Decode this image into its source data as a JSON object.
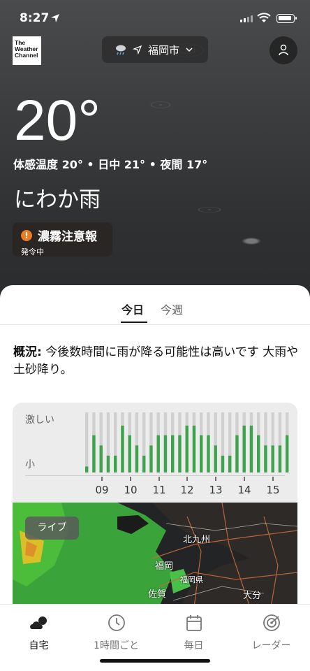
{
  "status": {
    "time": "8:27"
  },
  "brand": {
    "logo_text_1": "The",
    "logo_text_2": "Weather",
    "logo_text_3": "Channel"
  },
  "location": {
    "name": "福岡市",
    "weather_icon": "rain-cloud-icon"
  },
  "current": {
    "temperature": "20°",
    "feels_line": "体感温度 20° • 日中 21° • 夜間 17°",
    "condition": "にわか雨"
  },
  "alert": {
    "title": "濃霧注意報",
    "status": "発令中",
    "color": "#f07b1e"
  },
  "tabs": [
    {
      "label": "今日"
    },
    {
      "label": "今週"
    }
  ],
  "summary": {
    "label": "概況:",
    "text": "今後数時間に雨が降る可能性は高いです 大雨や土砂降り。"
  },
  "chart_data": {
    "type": "bar",
    "ylabels": [
      "激しい",
      "小"
    ],
    "x_ticks": [
      "09",
      "10",
      "11",
      "12",
      "13",
      "14",
      "15"
    ],
    "values": [
      0.1,
      0.62,
      0.45,
      0.28,
      0.28,
      0.78,
      0.62,
      0.45,
      0.28,
      0.45,
      0.62,
      0.62,
      0.62,
      0.62,
      0.78,
      0.78,
      0.62,
      0.62,
      0.45,
      0.28,
      0.28,
      0.62,
      0.78,
      0.78,
      0.62,
      0.45,
      0.45,
      0.45,
      0.62
    ],
    "ylim": [
      0,
      1
    ],
    "bar_color": "#3fa34d",
    "track_color": "#d0d0d0"
  },
  "map": {
    "live_label": "ライブ",
    "cities": [
      "北九州",
      "福岡",
      "福岡県",
      "佐賀",
      "大分"
    ]
  },
  "nav": [
    {
      "label": "自宅",
      "icon": "home-weather-icon"
    },
    {
      "label": "1時間ごと",
      "icon": "clock-icon"
    },
    {
      "label": "毎日",
      "icon": "calendar-icon"
    },
    {
      "label": "レーダー",
      "icon": "radar-icon"
    }
  ]
}
